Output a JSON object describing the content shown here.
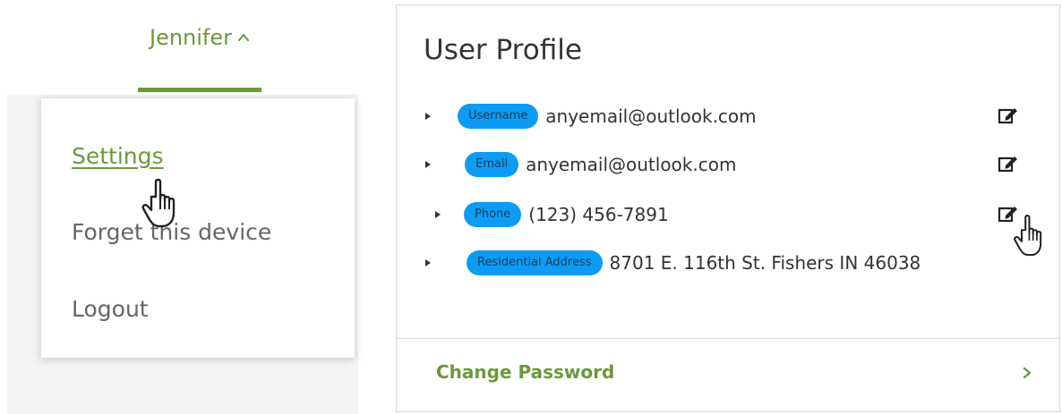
{
  "user_menu": {
    "username": "Jennifer",
    "caret_icon": "chevron-up-icon",
    "items": [
      {
        "label": "Settings",
        "active": true
      },
      {
        "label": "Forget this device",
        "active": false
      },
      {
        "label": "Logout",
        "active": false
      }
    ]
  },
  "profile": {
    "title": "User Profile",
    "fields": [
      {
        "badge": "Username",
        "value": "anyemail@outlook.com"
      },
      {
        "badge": "Email",
        "value": "anyemail@outlook.com"
      },
      {
        "badge": "Phone",
        "value": "(123) 456-7891"
      },
      {
        "badge": "Residential Address",
        "value": "8701 E. 116th St. Fishers IN 46038"
      }
    ],
    "change_password_label": "Change Password"
  },
  "colors": {
    "accent_green": "#6a9a3a",
    "badge_blue": "#0c9bf5",
    "badge_text": "#1d3c5a"
  },
  "icons": {
    "edit": "edit-icon",
    "expander": "caret-right-icon",
    "cursor": "hand-pointer-icon",
    "chevron": "chevron-right-icon"
  }
}
